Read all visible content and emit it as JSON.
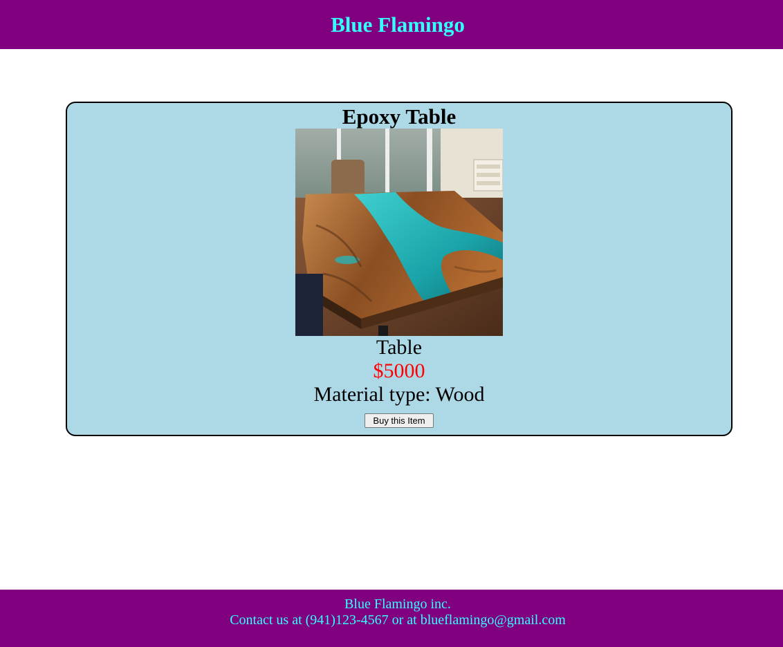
{
  "header": {
    "title": "Blue Flamingo",
    "background_color": "#800080",
    "title_color": "#33ffff"
  },
  "product": {
    "name": "Epoxy Table",
    "image_alt": "Epoxy Table",
    "type": "Table",
    "price": "$5000",
    "price_color": "#ff0000",
    "material": "Material type: Wood",
    "buy_label": "Buy this Item",
    "card_background": "#add8e6"
  },
  "footer": {
    "company": "Blue Flamingo inc.",
    "contact": "Contact us at (941)123-4567 or at blueflamingo@gmail.com"
  }
}
